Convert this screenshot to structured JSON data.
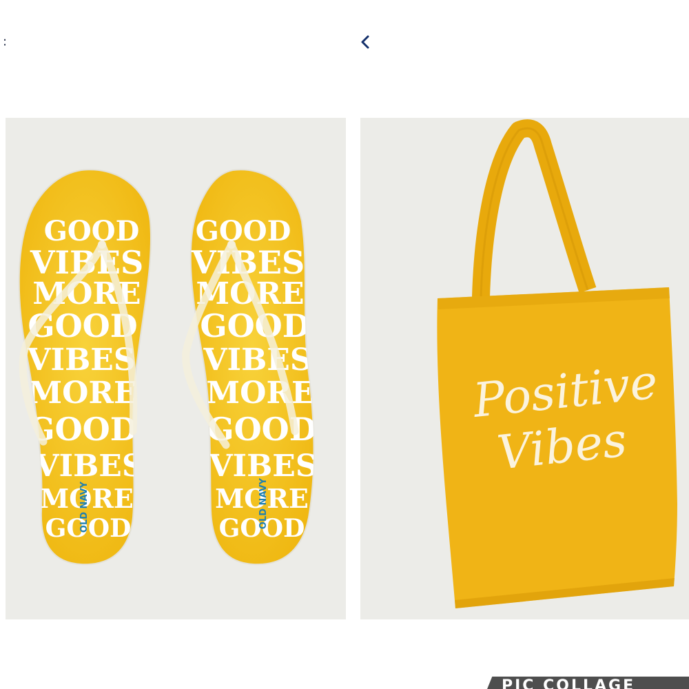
{
  "header": {
    "left_glyph": ":",
    "back_icon": "chevron-left-icon"
  },
  "products": [
    {
      "name": "flip-flops",
      "brand_label": "OLD NAVY",
      "print_words": [
        "GOOD",
        "VIBES",
        "MORE",
        "GOOD",
        "VIBES",
        "MORE",
        "GOOD",
        "VIBES",
        "MORE",
        "GOOD"
      ]
    },
    {
      "name": "tote-bag",
      "print_line1": "Positive",
      "print_line2": "Vibes"
    }
  ],
  "watermark": {
    "text": "PIC COLLAGE"
  },
  "colors": {
    "sandal_yellow": "#f4c21a",
    "tote_yellow": "#f0b416",
    "panel_bg": "#ecece8",
    "print_white": "#ffffff",
    "brand_blue": "#1e7fb0",
    "back_icon": "#14306b"
  }
}
